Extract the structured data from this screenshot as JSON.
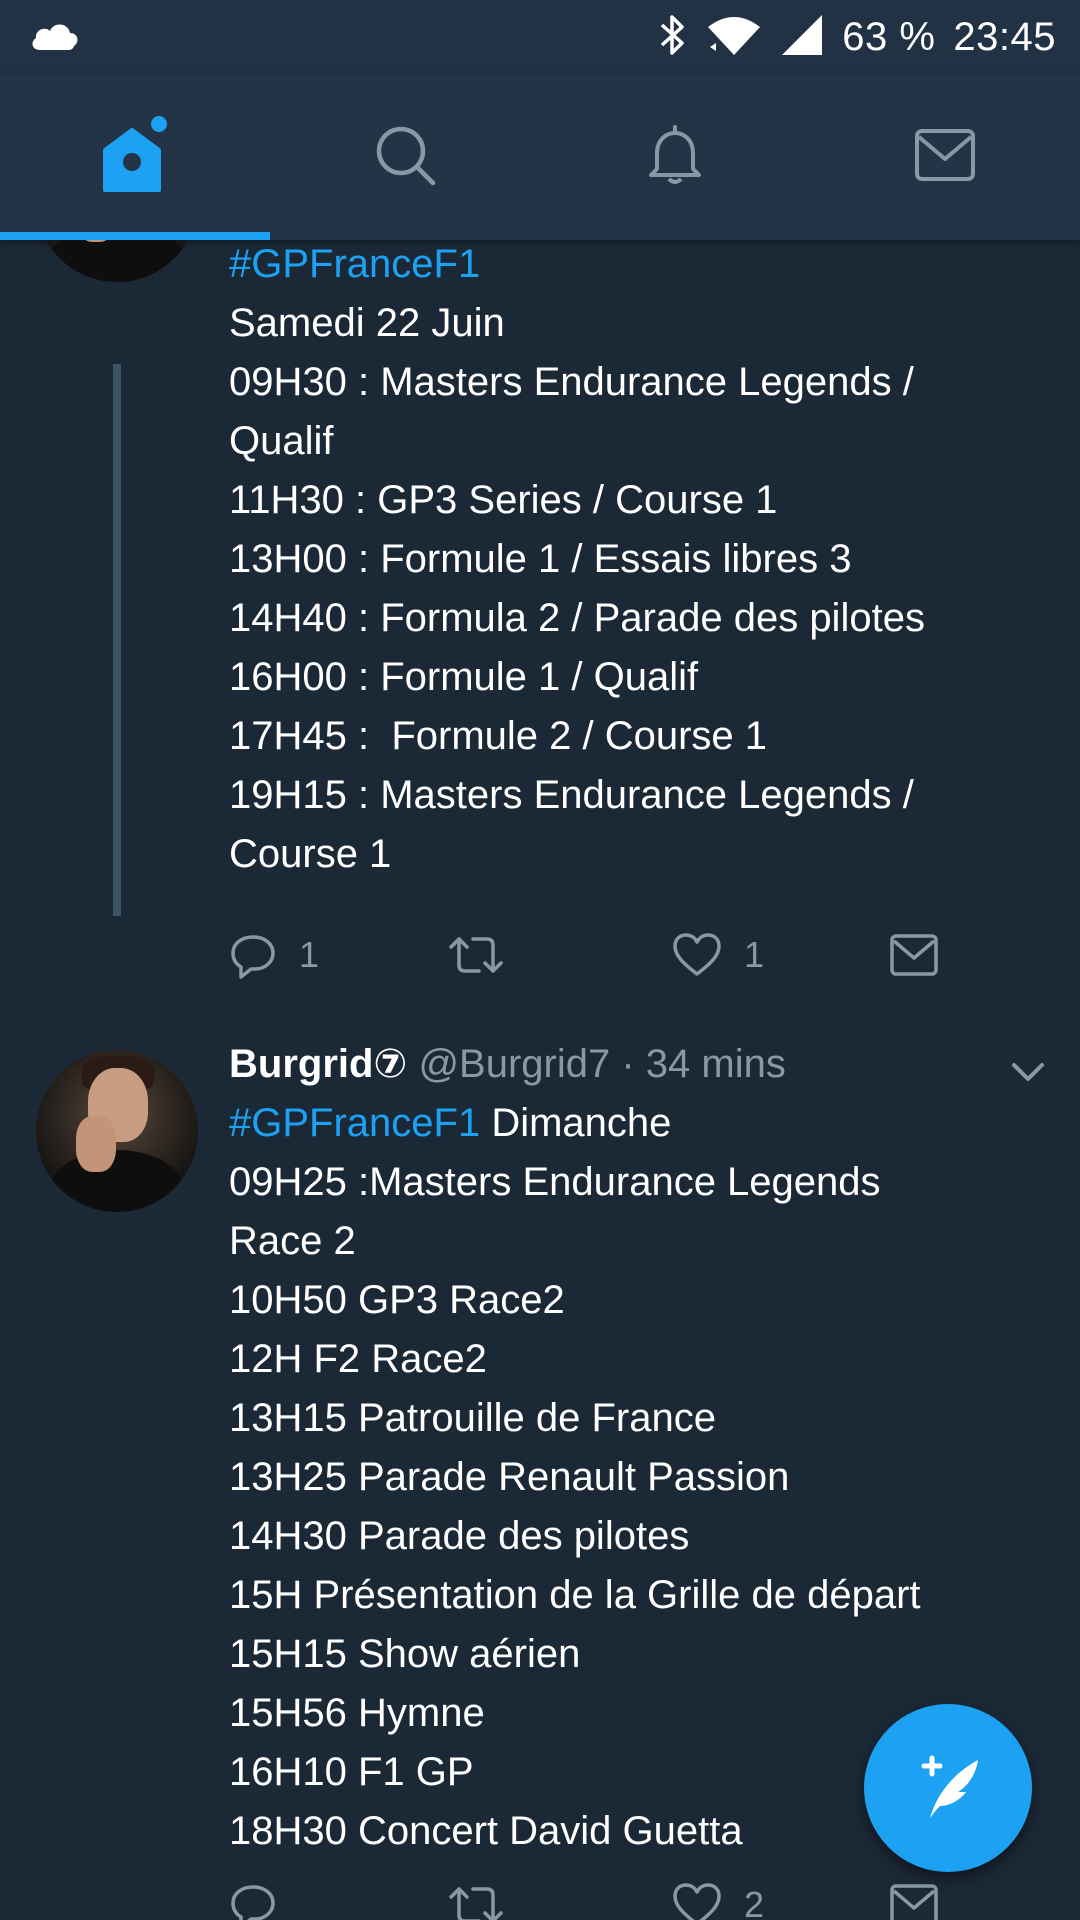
{
  "status_bar": {
    "battery": "63 %",
    "time": "23:45",
    "icons": [
      "cloud-icon",
      "bluetooth-icon",
      "wifi-icon",
      "signal-icon"
    ]
  },
  "tabs": [
    {
      "name": "home",
      "icon": "home-icon",
      "active": true
    },
    {
      "name": "search",
      "icon": "search-icon",
      "active": false
    },
    {
      "name": "notifications",
      "icon": "bell-icon",
      "active": false
    },
    {
      "name": "messages",
      "icon": "mail-icon",
      "active": false
    }
  ],
  "accent_color": "#1da1f2",
  "tweets": [
    {
      "hashtag": "#GPFranceF1",
      "lines": [
        "Samedi 22 Juin",
        "09H30 : Masters Endurance Legends /",
        "Qualif",
        "11H30 : GP3 Series / Course 1",
        "13H00 : Formule 1 / Essais libres 3",
        "14H40 : Formula 2 / Parade des pilotes",
        "16H00 : Formule 1 / Qualif",
        "17H45 :  Formule 2 / Course 1",
        "19H15 : Masters Endurance Legends /",
        "Course 1"
      ],
      "replies": "1",
      "retweets": "",
      "likes": "1"
    },
    {
      "display_name": "Burgrid⑦",
      "handle": "@Burgrid7",
      "time": "· 34 mins",
      "hashtag": "#GPFranceF1",
      "first_line_rest": " Dimanche",
      "lines": [
        "09H25 :Masters Endurance Legends",
        "Race 2",
        "10H50 GP3 Race2",
        "12H F2 Race2",
        "13H15 Patrouille de France",
        "13H25 Parade Renault Passion",
        "14H30 Parade des pilotes",
        "15H Présentation de la Grille de départ",
        "15H15 Show aérien",
        "15H56 Hymne",
        "16H10 F1 GP",
        "18H30 Concert David Guetta"
      ],
      "replies": "",
      "retweets": "",
      "likes": "2"
    }
  ],
  "fab": {
    "icon": "compose-tweet-icon"
  }
}
